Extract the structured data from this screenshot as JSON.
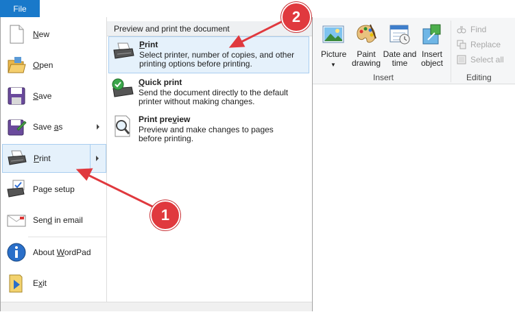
{
  "file_tab": {
    "label": "File"
  },
  "menu": {
    "items": [
      {
        "label_pre": "",
        "label_u": "N",
        "label_post": "ew",
        "icon": "new-document-icon"
      },
      {
        "label_pre": "",
        "label_u": "O",
        "label_post": "pen",
        "icon": "open-folder-icon"
      },
      {
        "label_pre": "",
        "label_u": "S",
        "label_post": "ave",
        "icon": "save-disk-icon"
      },
      {
        "label_pre": "Save ",
        "label_u": "a",
        "label_post": "s",
        "icon": "save-as-icon"
      },
      {
        "label_pre": "",
        "label_u": "P",
        "label_post": "rint",
        "icon": "printer-icon"
      },
      {
        "label_pre": "Pa",
        "label_u": "g",
        "label_post": "e setup",
        "icon": "page-setup-icon"
      },
      {
        "label_pre": "Sen",
        "label_u": "d",
        "label_post": " in email",
        "icon": "email-icon"
      },
      {
        "label_pre": "About ",
        "label_u": "W",
        "label_post": "ordPad",
        "icon": "info-icon"
      },
      {
        "label_pre": "E",
        "label_u": "x",
        "label_post": "it",
        "icon": "exit-icon"
      }
    ]
  },
  "print_panel": {
    "header": "Preview and print the document",
    "items": [
      {
        "title_u": "P",
        "title_rest": "rint",
        "description": "Select printer, number of copies, and other printing options before printing."
      },
      {
        "title_u": "Q",
        "title_rest": "uick print",
        "description": "Send the document directly to the default printer without making changes."
      },
      {
        "title_pre": "Print pre",
        "title_u": "v",
        "title_rest": "iew",
        "description": "Preview and make changes to pages before printing."
      }
    ]
  },
  "ribbon": {
    "insert_group": {
      "label": "Insert",
      "buttons": [
        {
          "label": "Picture",
          "icon": "picture-icon"
        },
        {
          "label": "Paint drawing",
          "line1": "Paint",
          "line2": "drawing",
          "icon": "paint-palette-icon"
        },
        {
          "label": "Date and time",
          "line1": "Date and",
          "line2": "time",
          "icon": "calendar-clock-icon"
        },
        {
          "label": "Insert object",
          "line1": "Insert",
          "line2": "object",
          "icon": "insert-object-icon"
        }
      ]
    },
    "editing_group": {
      "label": "Editing",
      "items": [
        {
          "label": "Find",
          "icon": "binoculars-icon"
        },
        {
          "label": "Replace",
          "icon": "replace-icon"
        },
        {
          "label": "Select all",
          "icon": "select-all-icon"
        }
      ]
    }
  },
  "annotations": {
    "badge1": "1",
    "badge2": "2",
    "color": "#e0393e"
  }
}
